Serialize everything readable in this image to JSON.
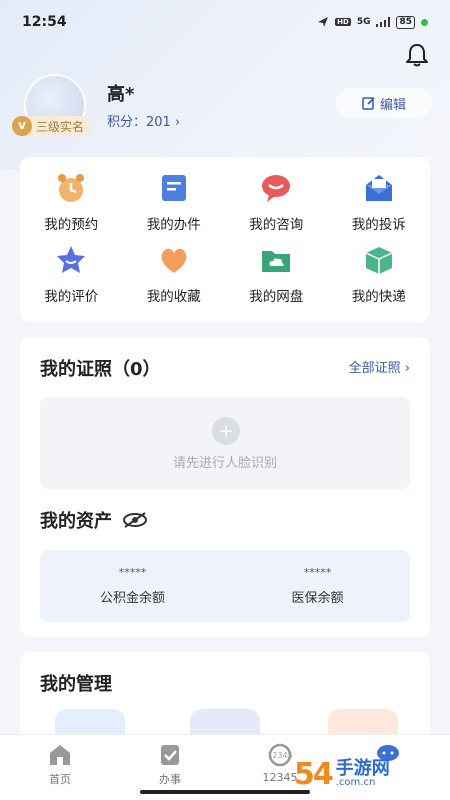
{
  "status": {
    "time": "12:54",
    "signal": "5G",
    "battery": "85"
  },
  "profile": {
    "name": "高*",
    "badge": "三级实名",
    "points_label": "积分：",
    "points": "201",
    "edit_label": "编辑"
  },
  "shortcuts": [
    {
      "label": "我的预约",
      "icon": "alarm-clock-icon"
    },
    {
      "label": "我的办件",
      "icon": "document-icon"
    },
    {
      "label": "我的咨询",
      "icon": "chat-bubble-icon"
    },
    {
      "label": "我的投诉",
      "icon": "envelope-icon"
    },
    {
      "label": "我的评价",
      "icon": "star-icon"
    },
    {
      "label": "我的收藏",
      "icon": "heart-icon"
    },
    {
      "label": "我的网盘",
      "icon": "cloud-folder-icon"
    },
    {
      "label": "我的快递",
      "icon": "package-icon"
    }
  ],
  "certificates": {
    "title": "我的证照（0）",
    "all_label": "全部证照",
    "face_prompt": "请先进行人脸识别"
  },
  "assets": {
    "title": "我的资产",
    "items": [
      {
        "value": "*****",
        "label": "公积金余额"
      },
      {
        "value": "*****",
        "label": "医保余额"
      }
    ]
  },
  "management": {
    "title": "我的管理"
  },
  "tabbar": [
    {
      "label": "首页"
    },
    {
      "label": "办事"
    },
    {
      "label": "12345"
    },
    {
      "label": ""
    }
  ],
  "watermark": {
    "num": "54",
    "text": "手游网",
    "domain": ".com.cn"
  },
  "colors": {
    "accent": "#3e5aa8",
    "badge": "#d9a44c"
  }
}
